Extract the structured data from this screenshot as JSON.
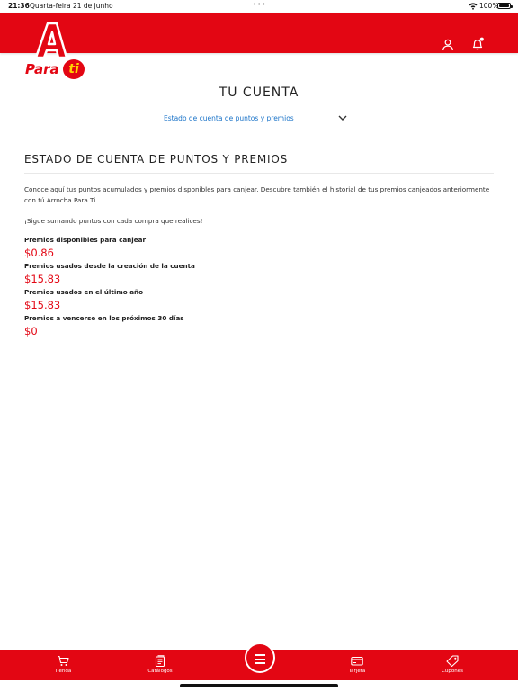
{
  "status_bar": {
    "time": "21:36",
    "date": "Quarta-feira 21 de junho",
    "battery": "100%"
  },
  "header": {
    "brand_para": "Para",
    "brand_ti": "ti",
    "icons": [
      "user-icon",
      "bell-icon"
    ],
    "accent_color": "#e30613"
  },
  "page": {
    "title": "TU CUENTA",
    "section_select": "Estado de cuenta de puntos y premios"
  },
  "statement": {
    "heading": "ESTADO DE CUENTA DE PUNTOS Y PREMIOS",
    "intro": "Conoce aquí tus puntos acumulados y premios disponibles para canjear. Descubre también el historial de tus premios canjeados anteriormente con tú Arrocha Para Ti.",
    "note": "¡Sigue sumando puntos con cada compra que realices!",
    "stats": [
      {
        "label": "Premios disponibles para canjear",
        "value": "$0.86"
      },
      {
        "label": "Premios usados desde la creación de la cuenta",
        "value": "$15.83"
      },
      {
        "label": "Premios usados en el último año",
        "value": "$15.83"
      },
      {
        "label": "Premios a vencerse en los próximos 30 días",
        "value": "$0"
      }
    ]
  },
  "tabbar": {
    "tabs": [
      {
        "label": "Tienda",
        "icon": "cart-icon"
      },
      {
        "label": "Catálogos",
        "icon": "catalog-icon"
      },
      {
        "label": "Tarjeta",
        "icon": "card-icon"
      },
      {
        "label": "Cupones",
        "icon": "coupon-icon"
      }
    ],
    "center_icon": "menu-icon"
  }
}
